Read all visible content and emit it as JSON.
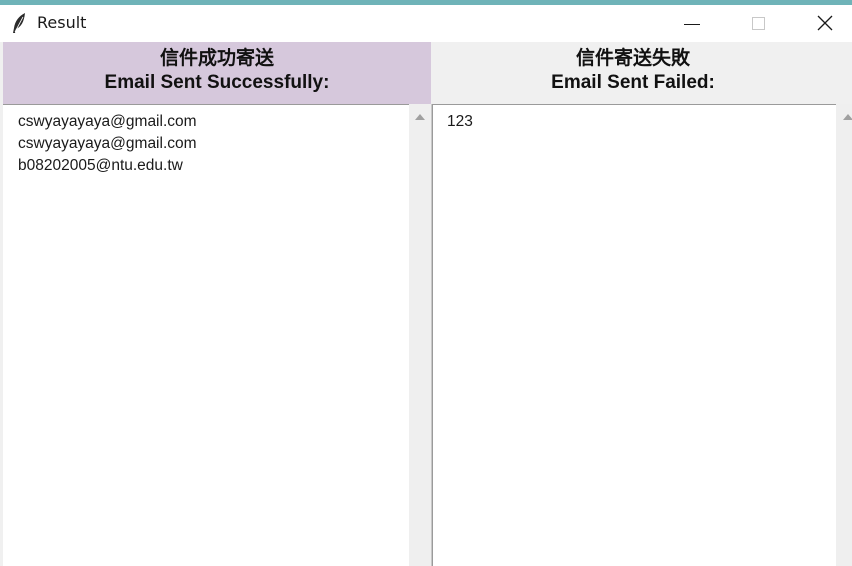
{
  "window": {
    "title": "Result",
    "icon": "feather-icon"
  },
  "success": {
    "header_cn": "信件成功寄送",
    "header_en": "Email Sent Successfully:",
    "items": [
      "cswyayayaya@gmail.com",
      "cswyayayaya@gmail.com",
      "b08202005@ntu.edu.tw"
    ],
    "header_color": "#d6c8dc"
  },
  "failed": {
    "header_cn": "信件寄送失敗",
    "header_en": "Email Sent Failed:",
    "items": [
      "123"
    ]
  }
}
